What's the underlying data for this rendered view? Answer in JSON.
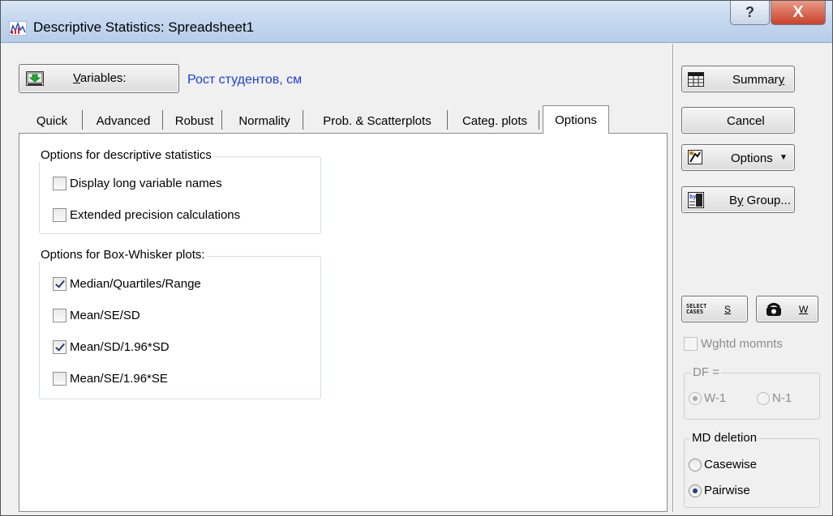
{
  "window": {
    "title": "Descriptive Statistics: Spreadsheet1",
    "help_label": "?",
    "close_label": "X"
  },
  "variables": {
    "button_label_u": "V",
    "button_label_rest": "ariables:",
    "value": "Рост студентов, см"
  },
  "tabs": [
    "Quick",
    "Advanced",
    "Robust",
    "Normality",
    "Prob. & Scatterplots",
    "Categ. plots",
    "Options"
  ],
  "active_tab": "Options",
  "options_group": {
    "title": "Options for descriptive statistics",
    "items": [
      {
        "label": "Display long variable names",
        "checked": false
      },
      {
        "label": "Extended precision calculations",
        "checked": false
      }
    ]
  },
  "boxwhisker_group": {
    "title": "Options for Box-Whisker plots:",
    "items": [
      {
        "label": "Median/Quartiles/Range",
        "checked": true
      },
      {
        "label": "Mean/SE/SD",
        "checked": false
      },
      {
        "label": "Mean/SD/1.96*SD",
        "checked": true
      },
      {
        "label": "Mean/SE/1.96*SE",
        "checked": false
      }
    ]
  },
  "side": {
    "summary_pre": "Summar",
    "summary_u": "y",
    "cancel": "Cancel",
    "options": "Options",
    "bygroup_pre": "B",
    "bygroup_u": "y",
    "bygroup_post": " Group...",
    "select_icon_line1": "SELECT",
    "select_icon_line2": "CASES",
    "select_key": "S",
    "weight_key": "W",
    "wghtd": "Wghtd momnts",
    "df_title": "DF =",
    "df_w1": "W-1",
    "df_n1": "N-1",
    "md_title": "MD deletion",
    "md_casewise": "Casewise",
    "md_pairwise": "Pairwise"
  }
}
